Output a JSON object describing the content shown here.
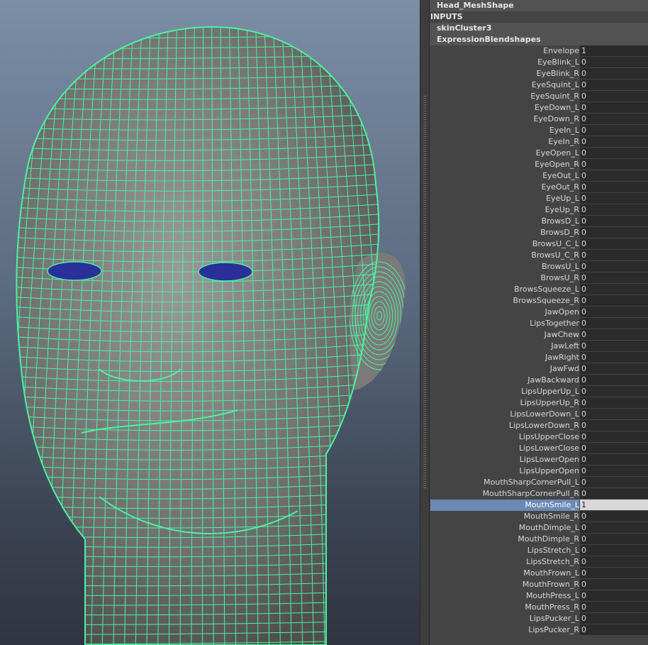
{
  "viewport": {
    "colors": {
      "wire": "#4cf2a0",
      "skin": "#8a8a8a",
      "eye": "#2a2f9a"
    }
  },
  "panel": {
    "node_title": "Head_MeshShape",
    "inputs_header": "INPUTS",
    "skin_cluster": "skinCluster3",
    "blendshape_node": "ExpressionBlendshapes",
    "selected_attribute": "MouthSmile_L",
    "attributes": [
      {
        "name": "Envelope",
        "value": "1"
      },
      {
        "name": "EyeBlink_L",
        "value": "0"
      },
      {
        "name": "EyeBlink_R",
        "value": "0"
      },
      {
        "name": "EyeSquint_L",
        "value": "0"
      },
      {
        "name": "EyeSquint_R",
        "value": "0"
      },
      {
        "name": "EyeDown_L",
        "value": "0"
      },
      {
        "name": "EyeDown_R",
        "value": "0"
      },
      {
        "name": "EyeIn_L",
        "value": "0"
      },
      {
        "name": "EyeIn_R",
        "value": "0"
      },
      {
        "name": "EyeOpen_L",
        "value": "0"
      },
      {
        "name": "EyeOpen_R",
        "value": "0"
      },
      {
        "name": "EyeOut_L",
        "value": "0"
      },
      {
        "name": "EyeOut_R",
        "value": "0"
      },
      {
        "name": "EyeUp_L",
        "value": "0"
      },
      {
        "name": "EyeUp_R",
        "value": "0"
      },
      {
        "name": "BrowsD_L",
        "value": "0"
      },
      {
        "name": "BrowsD_R",
        "value": "0"
      },
      {
        "name": "BrowsU_C_L",
        "value": "0"
      },
      {
        "name": "BrowsU_C_R",
        "value": "0"
      },
      {
        "name": "BrowsU_L",
        "value": "0"
      },
      {
        "name": "BrowsU_R",
        "value": "0"
      },
      {
        "name": "BrowsSqueeze_L",
        "value": "0"
      },
      {
        "name": "BrowsSqueeze_R",
        "value": "0"
      },
      {
        "name": "JawOpen",
        "value": "0"
      },
      {
        "name": "LipsTogether",
        "value": "0"
      },
      {
        "name": "JawChew",
        "value": "0"
      },
      {
        "name": "JawLeft",
        "value": "0"
      },
      {
        "name": "JawRight",
        "value": "0"
      },
      {
        "name": "JawFwd",
        "value": "0"
      },
      {
        "name": "JawBackward",
        "value": "0"
      },
      {
        "name": "LipsUpperUp_L",
        "value": "0"
      },
      {
        "name": "LipsUpperUp_R",
        "value": "0"
      },
      {
        "name": "LipsLowerDown_L",
        "value": "0"
      },
      {
        "name": "LipsLowerDown_R",
        "value": "0"
      },
      {
        "name": "LipsUpperClose",
        "value": "0"
      },
      {
        "name": "LipsLowerClose",
        "value": "0"
      },
      {
        "name": "LipsLowerOpen",
        "value": "0"
      },
      {
        "name": "LipsUpperOpen",
        "value": "0"
      },
      {
        "name": "MouthSharpCornerPull_L",
        "value": "0"
      },
      {
        "name": "MouthSharpCornerPull_R",
        "value": "0"
      },
      {
        "name": "MouthSmile_L",
        "value": "1"
      },
      {
        "name": "MouthSmile_R",
        "value": "0"
      },
      {
        "name": "MouthDimple_L",
        "value": "0"
      },
      {
        "name": "MouthDimple_R",
        "value": "0"
      },
      {
        "name": "LipsStretch_L",
        "value": "0"
      },
      {
        "name": "LipsStretch_R",
        "value": "0"
      },
      {
        "name": "MouthFrown_L",
        "value": "0"
      },
      {
        "name": "MouthFrown_R",
        "value": "0"
      },
      {
        "name": "MouthPress_L",
        "value": "0"
      },
      {
        "name": "MouthPress_R",
        "value": "0"
      },
      {
        "name": "LipsPucker_L",
        "value": "0"
      },
      {
        "name": "LipsPucker_R",
        "value": "0"
      }
    ]
  }
}
